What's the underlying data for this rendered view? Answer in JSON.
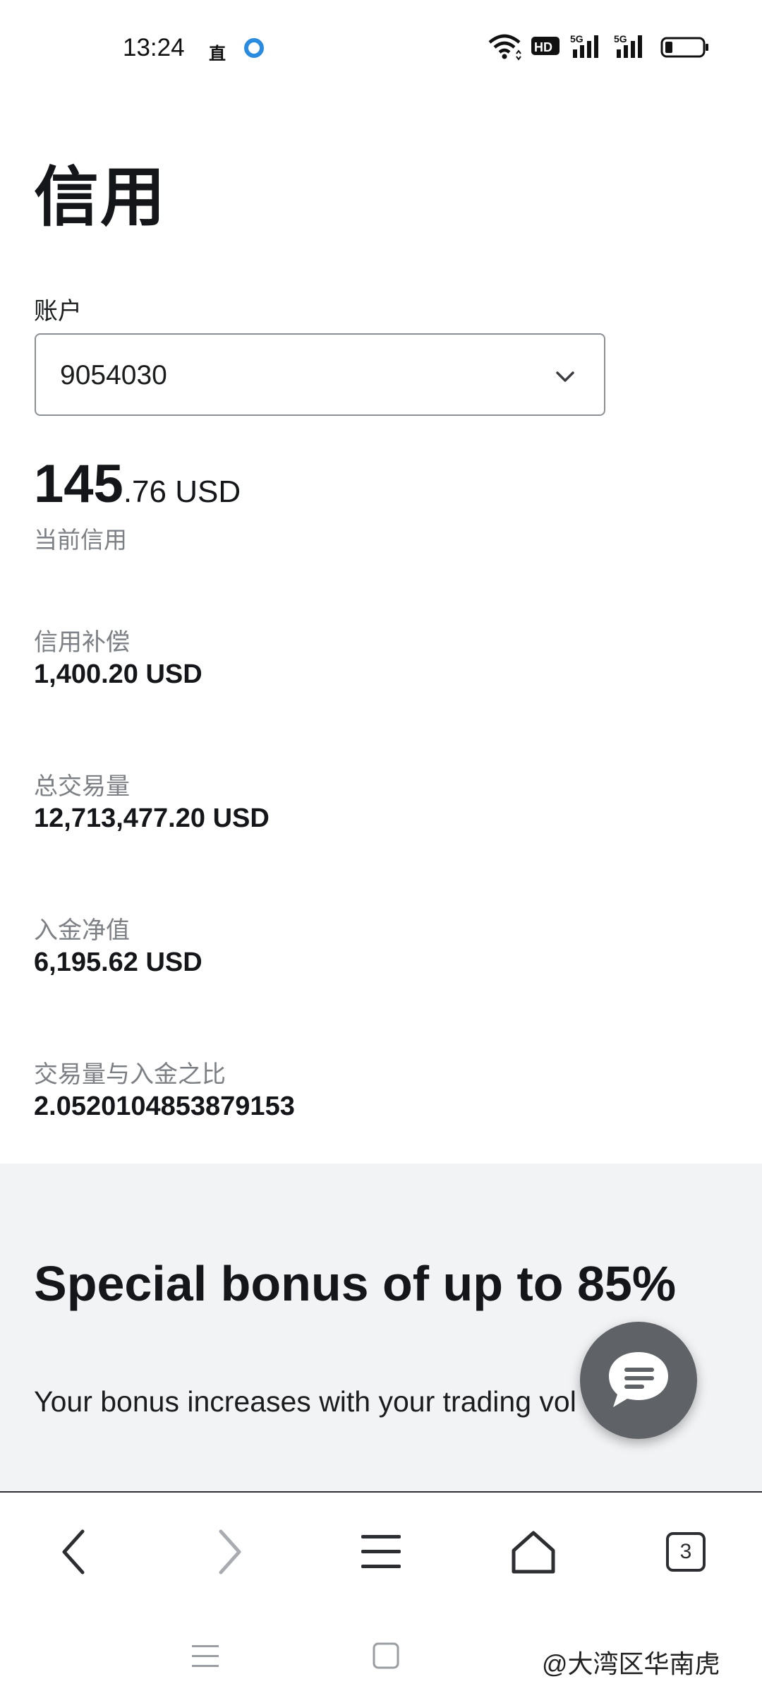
{
  "status_bar": {
    "time": "13:24",
    "indicator": "直",
    "icons": [
      "wifi-icon",
      "hd-icon",
      "5g-signal-icon",
      "5g-signal-icon",
      "battery-icon"
    ]
  },
  "page": {
    "title": "信用",
    "account_label": "账户",
    "account_value": "9054030",
    "credit": {
      "integer": "145",
      "decimal": ".76",
      "currency": " USD",
      "caption": "当前信用"
    },
    "stats": [
      {
        "label": "信用补偿",
        "value": "1,400.20 USD"
      },
      {
        "label": "总交易量",
        "value": "12,713,477.20 USD"
      },
      {
        "label": "入金净值",
        "value": "6,195.62 USD"
      },
      {
        "label": "交易量与入金之比",
        "value": "2.0520104853879153"
      }
    ]
  },
  "promo": {
    "title": "Special bonus of up to 85%",
    "text": "Your bonus increases with your trading vol"
  },
  "browser_bar": {
    "tab_count": "3",
    "icons": [
      "back-icon",
      "forward-icon",
      "menu-icon",
      "home-icon",
      "tabs-icon"
    ]
  },
  "watermark": "@大湾区华南虎",
  "colors": {
    "promo_bg": "#f2f3f5",
    "fab_bg": "#5f6266",
    "muted_text": "#7c7f84"
  }
}
